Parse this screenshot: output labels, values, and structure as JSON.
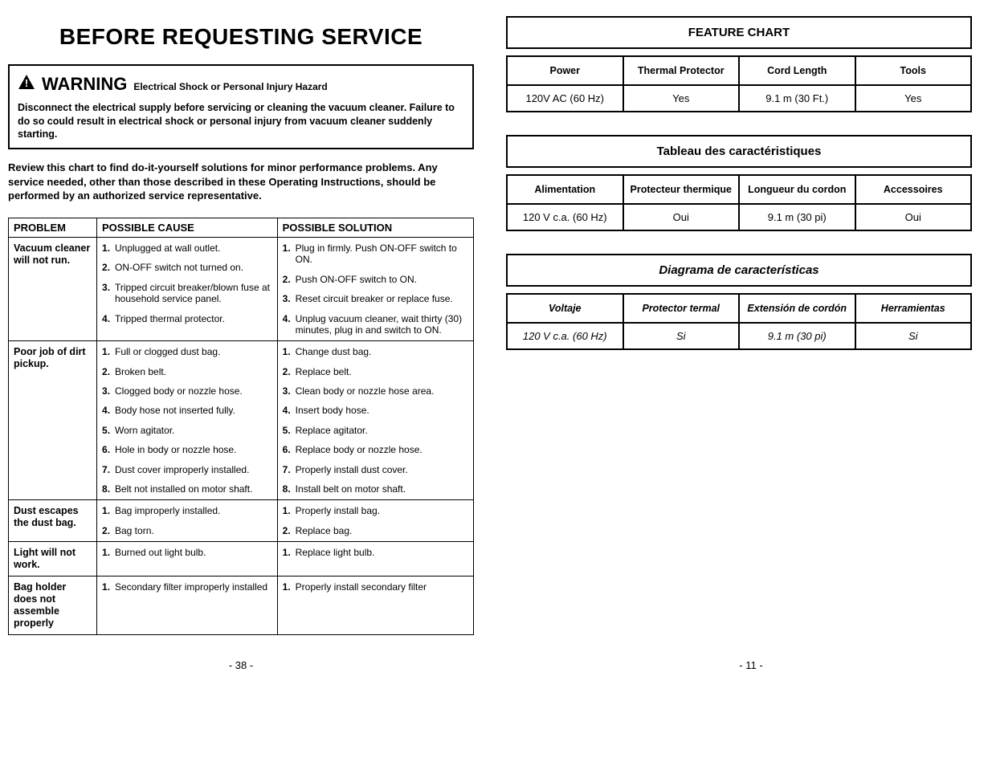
{
  "left": {
    "title": "BEFORE REQUESTING SERVICE",
    "warning_word": "WARNING",
    "warning_sub": "Electrical Shock or Personal Injury Hazard",
    "warning_body": "Disconnect the electrical supply before servicing or cleaning the vacuum cleaner. Failure to do so could result in electrical shock or personal injury from vacuum cleaner suddenly starting.",
    "review": "Review this chart to find do-it-yourself solutions for minor performance problems. Any service needed, other than those described in these Operating Instructions, should be performed by an authorized service representative.",
    "headers": {
      "problem": "PROBLEM",
      "cause": "POSSIBLE CAUSE",
      "solution": "POSSIBLE SOLUTION"
    },
    "rows": [
      {
        "problem": "Vacuum cleaner will not run.",
        "causes": [
          "Unplugged at wall outlet.",
          "ON-OFF switch not turned on.",
          "Tripped circuit breaker/blown fuse at household service panel.",
          "Tripped thermal protector."
        ],
        "solutions": [
          "Plug in firmly. Push ON-OFF switch to ON.",
          "Push ON-OFF switch to ON.",
          "Reset circuit breaker or replace fuse.",
          "Unplug vacuum cleaner, wait thirty (30) minutes, plug in and switch to ON."
        ]
      },
      {
        "problem": "Poor job of dirt pickup.",
        "causes": [
          "Full or clogged dust bag.",
          "Broken belt.",
          "Clogged body or nozzle hose.",
          "Body hose not inserted fully.",
          "Worn agitator.",
          "Hole in body or nozzle hose.",
          "Dust cover improperly installed.",
          "Belt not installed on motor shaft."
        ],
        "solutions": [
          "Change dust bag.",
          "Replace belt.",
          "Clean body or nozzle hose area.",
          "Insert body hose.",
          "Replace agitator.",
          "Replace body or nozzle hose.",
          "Properly install dust cover.",
          "Install belt on motor shaft."
        ]
      },
      {
        "problem": "Dust escapes the dust bag.",
        "causes": [
          "Bag improperly installed.",
          "Bag torn."
        ],
        "solutions": [
          "Properly install bag.",
          "Replace bag."
        ]
      },
      {
        "problem": "Light will not work.",
        "causes": [
          "Burned out light bulb."
        ],
        "solutions": [
          "Replace light bulb."
        ]
      },
      {
        "problem": "Bag holder does not assemble properly",
        "causes": [
          "Secondary filter improperly installed"
        ],
        "solutions": [
          "Properly install secondary filter"
        ]
      }
    ],
    "page": "- 38 -"
  },
  "right": {
    "tables": [
      {
        "title": "FEATURE CHART",
        "italic": false,
        "headers": [
          "Power",
          "Thermal Protector",
          "Cord Length",
          "Tools"
        ],
        "row": [
          "120V AC (60 Hz)",
          "Yes",
          "9.1 m (30 Ft.)",
          "Yes"
        ]
      },
      {
        "title": "Tableau des caractéristiques",
        "italic": false,
        "headers": [
          "Alimentation",
          "Protecteur thermique",
          "Longueur du cordon",
          "Accessoires"
        ],
        "row": [
          "120 V c.a. (60 Hz)",
          "Oui",
          "9.1 m (30 pi)",
          "Oui"
        ]
      },
      {
        "title": "Diagrama de características",
        "italic": true,
        "headers": [
          "Voltaje",
          "Protector termal",
          "Extensión de cordón",
          "Herramientas"
        ],
        "row": [
          "120 V c.a. (60 Hz)",
          "Si",
          "9.1 m  (30 pi)",
          "Si"
        ]
      }
    ],
    "page": "- 11 -"
  }
}
